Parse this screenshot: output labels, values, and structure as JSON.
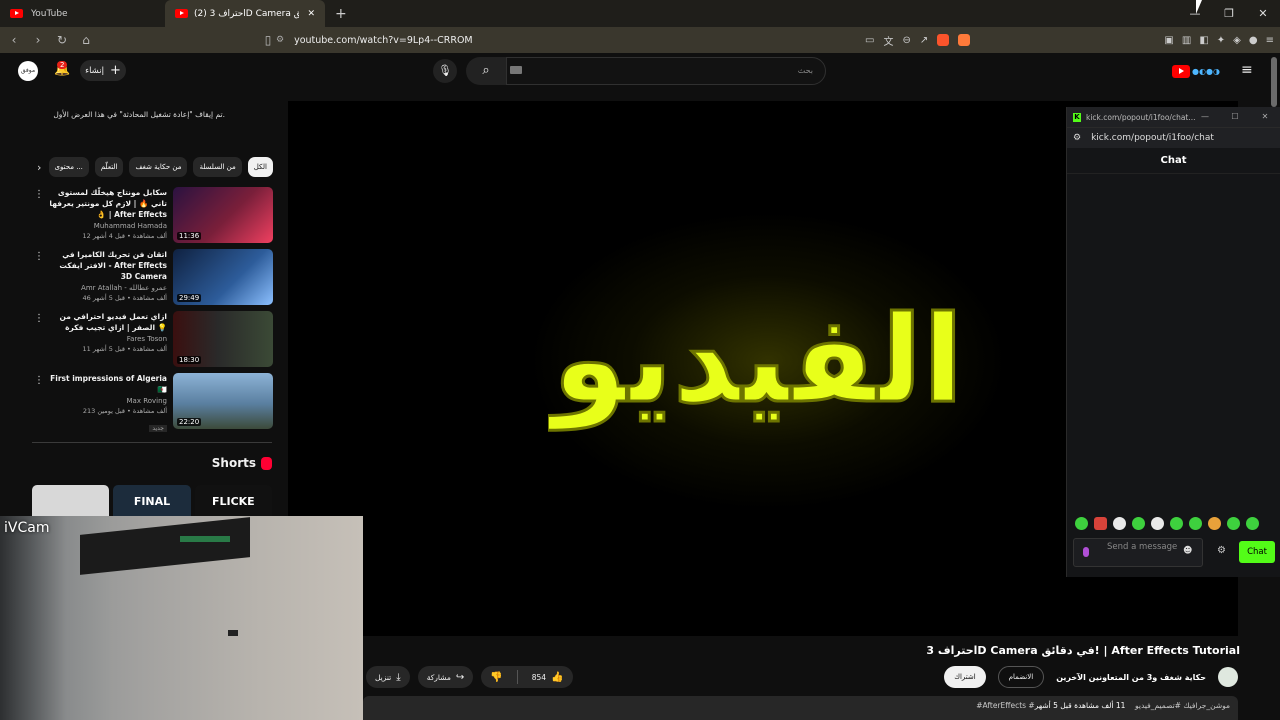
{
  "browser": {
    "tabs": [
      {
        "label": "YouTube",
        "active": false
      },
      {
        "label": "(2) احتراف 3D Camera في دقائق! ...",
        "active": true
      }
    ],
    "new_tab": "+",
    "url": "youtube.com/watch?v=9Lp4--CRROM"
  },
  "youtube": {
    "avatar_text": "موفق",
    "notifications_badge": "2",
    "create_label": "إنشاء",
    "search_placeholder": "بحث"
  },
  "autoplay_note": "تم إيقاف \"إعادة تشغيل المحادثة\" في هذا العرض الأول.",
  "chips": [
    {
      "label": "الكل",
      "selected": true
    },
    {
      "label": "من السلسلة",
      "selected": false
    },
    {
      "label": "من حكاية شغف",
      "selected": false
    },
    {
      "label": "التعلّم",
      "selected": false
    },
    {
      "label": "محتوى ...",
      "selected": false
    }
  ],
  "videos": [
    {
      "title": "سكابل مونتاج هيخلّك لمستوى تاني 🔥 | لازم كل مونتير يعرفها 👌 | After Effects",
      "channel": "Muhammad Hamada",
      "stats": "12 ألف مشاهدة • قبل 4 أشهر",
      "duration": "11:36",
      "thumb_color": "#3a1a50"
    },
    {
      "title": "اتقان فن تحريك الكاميرا في الافتر ايفكت - After Effects 3D Camera",
      "channel": "Amr Atallah - عمرو عطالله",
      "stats": "46 ألف مشاهدة • قبل 5 أشهر",
      "duration": "29:49",
      "thumb_color": "#1e3b66"
    },
    {
      "title": "ازاي تعمل فيديو احترافي من الصفر | ازاي تجيب فكرة 💡",
      "channel": "Fares Toson",
      "stats": "11 ألف مشاهدة • قبل 5 أشهر",
      "duration": "18:30",
      "thumb_color": "#2f2f2f"
    },
    {
      "title": "First impressions of Algeria 🇩🇿",
      "channel": "Max Roving",
      "stats": "213 ألف مشاهدة • قبل يومين",
      "duration": "22:20",
      "badge": "جديد",
      "thumb_color": "#5a7fa0"
    }
  ],
  "shorts": {
    "title": "Shorts",
    "items": [
      {
        "text": "",
        "color": "#d8d8d8"
      },
      {
        "text": "FINAL",
        "color": "#1c2c3c"
      },
      {
        "text": "FLICKE",
        "color": "#111"
      }
    ]
  },
  "webcam_label": "iVCam",
  "player": {
    "overlay_text": "الفيديو"
  },
  "kick": {
    "window_title": "kick.com/popout/i1foo/chat...",
    "url": "kick.com/popout/i1foo/chat",
    "header": "Chat",
    "input_placeholder": "Send a message",
    "chat_button": "Chat"
  },
  "video": {
    "title": "احتراف 3D Camera في دقائق! | After Effects Tutorial",
    "channel": "حكاية شغف و3 من المتعاونين الآخرين",
    "join_label": "الانضمام",
    "subscribe_label": "اشتراك",
    "likes": "854",
    "share_label": "مشاركة",
    "download_label": "تنزيل",
    "desc_stats": "11 ألف مشاهدة قبل 5 أشهر",
    "desc_tags": "#AfterEffects #موشن_جرافيك #تصميم_فيديو",
    "desc_line2": "... After Effects ..."
  },
  "colors": {
    "background": "#0f0f0f",
    "accent_red": "#ff0000",
    "kick_green": "#53fc18",
    "glow_yellow": "#e8ff1a"
  }
}
